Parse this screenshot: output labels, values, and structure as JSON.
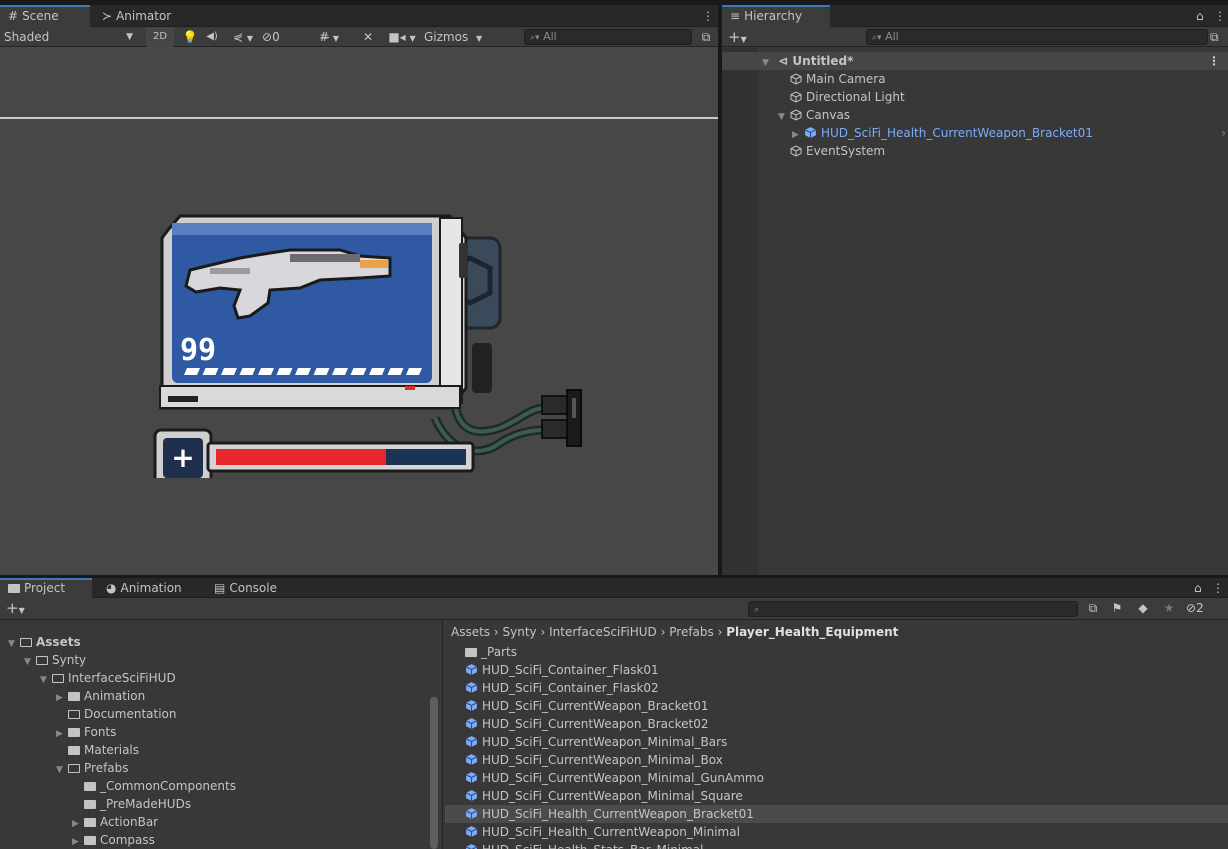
{
  "scene_panel": {
    "tabs": [
      {
        "label": "Scene",
        "icon": "grid-icon"
      },
      {
        "label": "Animator",
        "icon": "animator-icon"
      }
    ],
    "toolbar": {
      "shading_mode": "Shaded",
      "mode_2d": "2D",
      "hidden_count": "0",
      "gizmos_label": "Gizmos",
      "search_placeholder": "All"
    },
    "hud": {
      "ammo_count": "99",
      "health_fill": 0.68
    }
  },
  "hierarchy": {
    "tab_label": "Hierarchy",
    "search_placeholder": "All",
    "scene_name": "Untitled*",
    "items": [
      {
        "label": "Main Camera"
      },
      {
        "label": "Directional Light"
      },
      {
        "label": "Canvas"
      },
      {
        "label": "HUD_SciFi_Health_CurrentWeapon_Bracket01"
      },
      {
        "label": "EventSystem"
      }
    ]
  },
  "project": {
    "tabs": [
      {
        "label": "Project"
      },
      {
        "label": "Animation"
      },
      {
        "label": "Console"
      }
    ],
    "hidden_count": "2",
    "tree": [
      {
        "label": "Assets"
      },
      {
        "label": "Synty"
      },
      {
        "label": "InterfaceSciFiHUD"
      },
      {
        "label": "Animation"
      },
      {
        "label": "Documentation"
      },
      {
        "label": "Fonts"
      },
      {
        "label": "Materials"
      },
      {
        "label": "Prefabs"
      },
      {
        "label": "_CommonComponents"
      },
      {
        "label": "_PreMadeHUDs"
      },
      {
        "label": "ActionBar"
      },
      {
        "label": "Compass"
      }
    ],
    "breadcrumb": [
      "Assets",
      "Synty",
      "InterfaceSciFiHUD",
      "Prefabs",
      "Player_Health_Equipment"
    ],
    "assets": [
      {
        "label": "_Parts"
      },
      {
        "label": "HUD_SciFi_Container_Flask01"
      },
      {
        "label": "HUD_SciFi_Container_Flask02"
      },
      {
        "label": "HUD_SciFi_CurrentWeapon_Bracket01"
      },
      {
        "label": "HUD_SciFi_CurrentWeapon_Bracket02"
      },
      {
        "label": "HUD_SciFi_CurrentWeapon_Minimal_Bars"
      },
      {
        "label": "HUD_SciFi_CurrentWeapon_Minimal_Box"
      },
      {
        "label": "HUD_SciFi_CurrentWeapon_Minimal_GunAmmo"
      },
      {
        "label": "HUD_SciFi_CurrentWeapon_Minimal_Square"
      },
      {
        "label": "HUD_SciFi_Health_CurrentWeapon_Bracket01"
      },
      {
        "label": "HUD_SciFi_Health_CurrentWeapon_Minimal"
      },
      {
        "label": "HUD_SciFi_Health_Stats_Bar_Minimal"
      }
    ]
  },
  "colors": {
    "accent": "#3a79bb",
    "prefab_blue": "#7cacf8",
    "health_red": "#e8262e",
    "card_blue": "#2f5aa3"
  }
}
